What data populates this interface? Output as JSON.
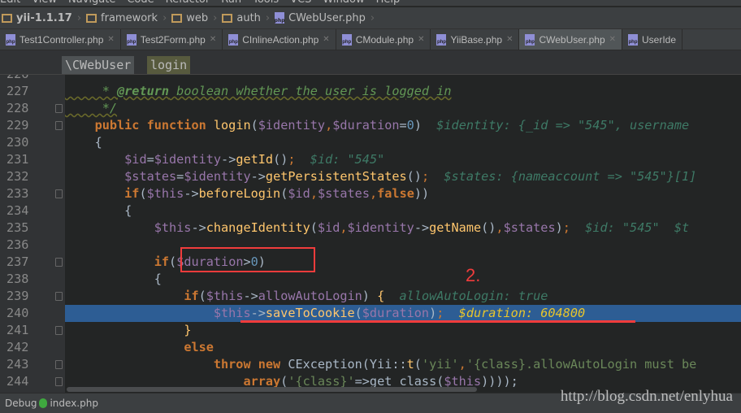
{
  "menu": [
    "Edit",
    "View",
    "Navigate",
    "Code",
    "Refactor",
    "Run",
    "Tools",
    "VCS",
    "Window",
    "Help"
  ],
  "breadcrumb": [
    {
      "label": "yii-1.1.17",
      "icon": "folder-icon"
    },
    {
      "label": "framework",
      "icon": "folder-icon"
    },
    {
      "label": "web",
      "icon": "folder-icon"
    },
    {
      "label": "auth",
      "icon": "folder-icon"
    },
    {
      "label": "CWebUser.php",
      "icon": "php-file-icon"
    }
  ],
  "tabs": [
    {
      "label": "Test1Controller.php"
    },
    {
      "label": "Test2Form.php"
    },
    {
      "label": "CInlineAction.php"
    },
    {
      "label": "CModule.php"
    },
    {
      "label": "YiiBase.php"
    },
    {
      "label": "CWebUser.php",
      "active": true
    },
    {
      "label": "UserIde"
    }
  ],
  "structure": {
    "class": "\\CWebUser",
    "method": "login"
  },
  "code": [
    {
      "n": "226",
      "t": []
    },
    {
      "n": "227",
      "t": [
        [
          "     * ",
          "c"
        ],
        [
          "@return",
          "ct"
        ],
        [
          " boolean whether the user is logged in",
          "c"
        ]
      ]
    },
    {
      "n": "228",
      "fold": true,
      "t": [
        [
          "     */",
          "c"
        ]
      ]
    },
    {
      "n": "229",
      "fold": true,
      "t": [
        [
          "    ",
          "p"
        ],
        [
          "public function ",
          "k"
        ],
        [
          "login",
          "f"
        ],
        [
          "(",
          "p"
        ],
        [
          "$identity",
          "v"
        ],
        [
          ",",
          "o"
        ],
        [
          "$duration",
          "v"
        ],
        [
          "=",
          "p"
        ],
        [
          "0",
          "n"
        ],
        [
          ")",
          "p"
        ],
        [
          "  $identity: {_id => \"545\", username",
          "d"
        ]
      ]
    },
    {
      "n": "230",
      "t": [
        [
          "    {",
          "p"
        ]
      ]
    },
    {
      "n": "231",
      "t": [
        [
          "        ",
          "p"
        ],
        [
          "$id",
          "v"
        ],
        [
          "=",
          "p"
        ],
        [
          "$identity",
          "v"
        ],
        [
          "->",
          "p"
        ],
        [
          "getId",
          "f"
        ],
        [
          "()",
          "p"
        ],
        [
          ";",
          "o"
        ],
        [
          "  $id: \"545\"",
          "d"
        ]
      ]
    },
    {
      "n": "232",
      "t": [
        [
          "        ",
          "p"
        ],
        [
          "$states",
          "v"
        ],
        [
          "=",
          "p"
        ],
        [
          "$identity",
          "v"
        ],
        [
          "->",
          "p"
        ],
        [
          "getPersistentStates",
          "f"
        ],
        [
          "()",
          "p"
        ],
        [
          ";",
          "o"
        ],
        [
          "  $states: {nameaccount => \"545\"}[1]",
          "d"
        ]
      ]
    },
    {
      "n": "233",
      "fold": true,
      "t": [
        [
          "        ",
          "p"
        ],
        [
          "if",
          "k"
        ],
        [
          "(",
          "p"
        ],
        [
          "$this",
          "v"
        ],
        [
          "->",
          "p"
        ],
        [
          "beforeLogin",
          "f"
        ],
        [
          "(",
          "p"
        ],
        [
          "$id",
          "v"
        ],
        [
          ",",
          "o"
        ],
        [
          "$states",
          "v"
        ],
        [
          ",",
          "o"
        ],
        [
          "false",
          "k"
        ],
        [
          "))",
          "p"
        ]
      ]
    },
    {
      "n": "234",
      "t": [
        [
          "        {",
          "p"
        ]
      ]
    },
    {
      "n": "235",
      "t": [
        [
          "            ",
          "p"
        ],
        [
          "$this",
          "v"
        ],
        [
          "->",
          "p"
        ],
        [
          "changeIdentity",
          "f"
        ],
        [
          "(",
          "p"
        ],
        [
          "$id",
          "v"
        ],
        [
          ",",
          "o"
        ],
        [
          "$identity",
          "v"
        ],
        [
          "->",
          "p"
        ],
        [
          "getName",
          "f"
        ],
        [
          "()",
          "p"
        ],
        [
          ",",
          "o"
        ],
        [
          "$states",
          "v"
        ],
        [
          ")",
          "p"
        ],
        [
          ";",
          "o"
        ],
        [
          "  $id: \"545\"  $t",
          "d"
        ]
      ]
    },
    {
      "n": "236",
      "t": []
    },
    {
      "n": "237",
      "fold": true,
      "t": [
        [
          "            ",
          "p"
        ],
        [
          "if",
          "k"
        ],
        [
          "(",
          "p"
        ],
        [
          "$duration",
          "v"
        ],
        [
          ">",
          "p"
        ],
        [
          "0",
          "n"
        ],
        [
          ")",
          "p"
        ]
      ]
    },
    {
      "n": "238",
      "t": [
        [
          "            {",
          "p"
        ]
      ]
    },
    {
      "n": "239",
      "fold": true,
      "t": [
        [
          "                ",
          "p"
        ],
        [
          "if",
          "k"
        ],
        [
          "(",
          "p"
        ],
        [
          "$this",
          "v"
        ],
        [
          "->",
          "p"
        ],
        [
          "allowAutoLogin",
          "v"
        ],
        [
          ") ",
          "p"
        ],
        [
          "{",
          "f"
        ],
        [
          "  allowAutoLogin: true",
          "d"
        ]
      ]
    },
    {
      "n": "240",
      "hl": true,
      "t": [
        [
          "                    ",
          "p"
        ],
        [
          "$this",
          "v"
        ],
        [
          "->",
          "p"
        ],
        [
          "saveToCookie",
          "f"
        ],
        [
          "(",
          "p"
        ],
        [
          "$duration",
          "v"
        ],
        [
          ")",
          "p"
        ],
        [
          ";",
          "o"
        ],
        [
          "  $duration: 604800",
          "dy"
        ]
      ]
    },
    {
      "n": "241",
      "fold": true,
      "t": [
        [
          "                ",
          "p"
        ],
        [
          "}",
          "f"
        ]
      ]
    },
    {
      "n": "242",
      "t": [
        [
          "                ",
          "p"
        ],
        [
          "else",
          "k"
        ]
      ]
    },
    {
      "n": "243",
      "fold": true,
      "t": [
        [
          "                    ",
          "p"
        ],
        [
          "throw new ",
          "k"
        ],
        [
          "CException",
          "p"
        ],
        [
          "(",
          "p"
        ],
        [
          "Yii",
          "p"
        ],
        [
          "::",
          "p"
        ],
        [
          "t",
          "f"
        ],
        [
          "(",
          "p"
        ],
        [
          "'yii'",
          "s"
        ],
        [
          ",",
          "o"
        ],
        [
          "'{class}.allowAutoLogin must be",
          "s"
        ]
      ]
    },
    {
      "n": "244",
      "fold": true,
      "t": [
        [
          "                        ",
          "p"
        ],
        [
          "array",
          "k"
        ],
        [
          "(",
          "p"
        ],
        [
          "'{class}'",
          "s"
        ],
        [
          "=>",
          "p"
        ],
        [
          "get_class",
          "p"
        ],
        [
          "(",
          "p"
        ],
        [
          "$this",
          "v"
        ],
        [
          "))));",
          "p"
        ]
      ]
    }
  ],
  "annotation": "2.",
  "status": {
    "label": "Debug",
    "file": "index.php"
  },
  "watermark": "http://blog.csdn.net/enlyhua"
}
